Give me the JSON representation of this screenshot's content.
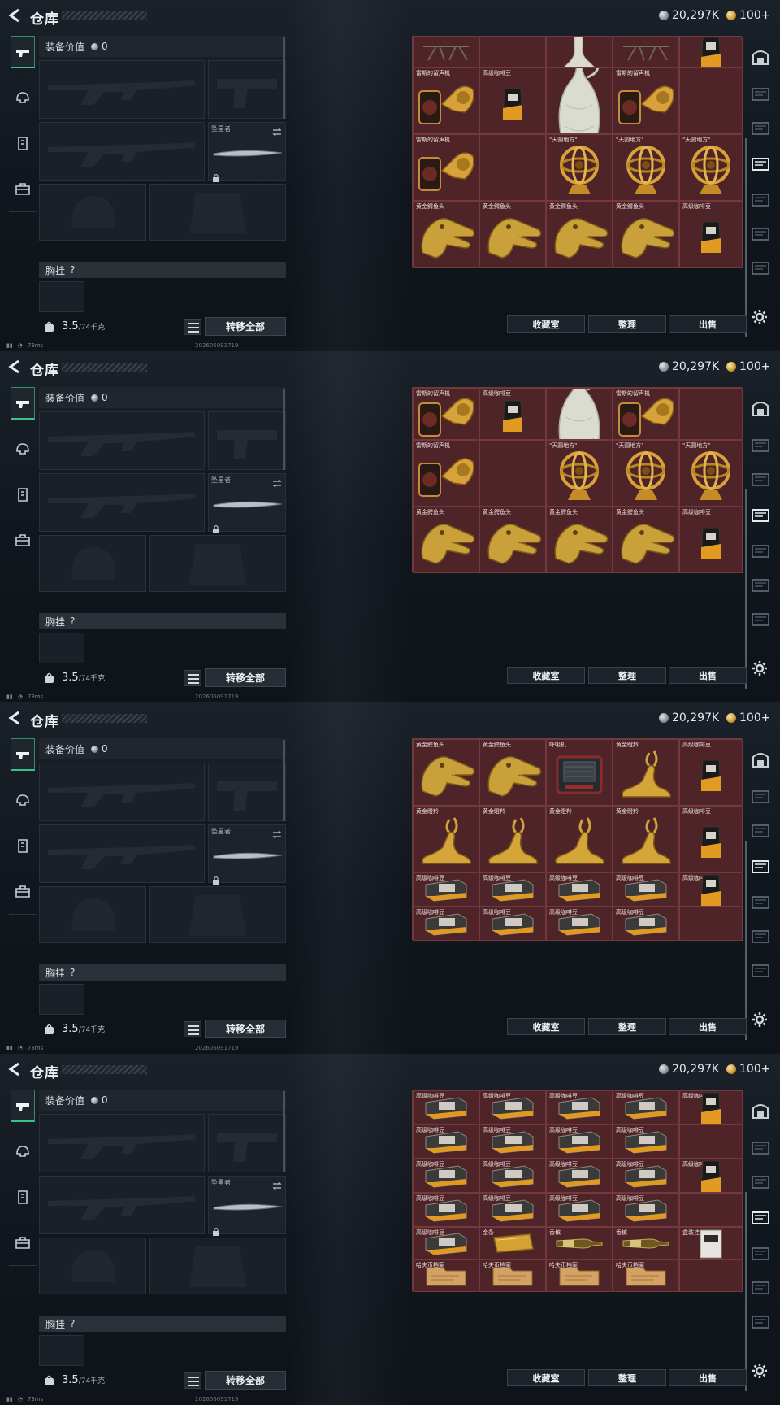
{
  "title": "仓库",
  "currency": {
    "silver": "20,297K",
    "gold": "100+"
  },
  "equip": {
    "value_label": "装备价值",
    "value": "0",
    "knife_name": "坠星者",
    "vest_label": "胸挂",
    "vest_hint": "?",
    "weight": "3.5",
    "weight_max": "/74千克",
    "transfer_label": "转移全部"
  },
  "status": {
    "ping": "73ms",
    "stamp": "202606091719"
  },
  "buttons": {
    "collection": "收藏室",
    "sort": "整理",
    "sell": "出售"
  },
  "colors": {
    "grid": "#5c2a2e",
    "active_tab": "#3cc18b"
  },
  "frames": [
    {
      "rows": [
        {
          "cells": [
            {
              "name": "",
              "icon": "tripod"
            },
            {
              "name": "",
              "icon": "none"
            },
            {
              "name": "",
              "icon": "vase-top"
            },
            {
              "name": "",
              "icon": "tripod"
            },
            {
              "name": "",
              "icon": "coffee-bag"
            }
          ]
        },
        {
          "cells": [
            {
              "name": "雷斯的留声机",
              "icon": "gramophone"
            },
            {
              "name": "高级咖啡豆",
              "icon": "coffee-bag"
            },
            {
              "name": "",
              "icon": "vase"
            },
            {
              "name": "雷斯的留声机",
              "icon": "gramophone"
            },
            {
              "name": "",
              "icon": "none"
            }
          ]
        },
        {
          "cells": [
            {
              "name": "雷斯的留声机",
              "icon": "gramophone"
            },
            {
              "name": "",
              "icon": "none"
            },
            {
              "name": "\"天圆地方\"",
              "icon": "armillary"
            },
            {
              "name": "\"天圆地方\"",
              "icon": "armillary"
            },
            {
              "name": "\"天圆地方\"",
              "icon": "armillary"
            }
          ]
        },
        {
          "cells": [
            {
              "name": "黄金鳄鱼头",
              "icon": "croc"
            },
            {
              "name": "黄金鳄鱼头",
              "icon": "croc"
            },
            {
              "name": "黄金鳄鱼头",
              "icon": "croc"
            },
            {
              "name": "黄金鳄鱼头",
              "icon": "croc"
            },
            {
              "name": "高级咖啡豆",
              "icon": "coffee-bag"
            }
          ]
        }
      ]
    },
    {
      "rows": [
        {
          "cells": [
            {
              "name": "雷斯的留声机",
              "icon": "gramophone"
            },
            {
              "name": "高级咖啡豆",
              "icon": "coffee-bag"
            },
            {
              "name": "",
              "icon": "vase"
            },
            {
              "name": "雷斯的留声机",
              "icon": "gramophone"
            },
            {
              "name": "",
              "icon": "none"
            }
          ]
        },
        {
          "cells": [
            {
              "name": "雷斯的留声机",
              "icon": "gramophone"
            },
            {
              "name": "",
              "icon": "none"
            },
            {
              "name": "\"天圆地方\"",
              "icon": "armillary"
            },
            {
              "name": "\"天圆地方\"",
              "icon": "armillary"
            },
            {
              "name": "\"天圆地方\"",
              "icon": "armillary"
            }
          ]
        },
        {
          "cells": [
            {
              "name": "黄金鳄鱼头",
              "icon": "croc"
            },
            {
              "name": "黄金鳄鱼头",
              "icon": "croc"
            },
            {
              "name": "黄金鳄鱼头",
              "icon": "croc"
            },
            {
              "name": "黄金鳄鱼头",
              "icon": "croc"
            },
            {
              "name": "高级咖啡豆",
              "icon": "coffee-bag"
            }
          ]
        }
      ]
    },
    {
      "rows": [
        {
          "cells": [
            {
              "name": "黄金鳄鱼头",
              "icon": "croc"
            },
            {
              "name": "黄金鳄鱼头",
              "icon": "croc"
            },
            {
              "name": "呼吸机",
              "icon": "ventilator"
            },
            {
              "name": "黄金瞪羚",
              "icon": "gazelle"
            },
            {
              "name": "高级咖啡豆",
              "icon": "coffee-bag"
            }
          ]
        },
        {
          "cells": [
            {
              "name": "黄金瞪羚",
              "icon": "gazelle"
            },
            {
              "name": "黄金瞪羚",
              "icon": "gazelle"
            },
            {
              "name": "黄金瞪羚",
              "icon": "gazelle"
            },
            {
              "name": "黄金瞪羚",
              "icon": "gazelle"
            },
            {
              "name": "高级咖啡豆",
              "icon": "coffee-bag"
            }
          ]
        },
        {
          "cells": [
            {
              "name": "高级咖啡豆",
              "icon": "coffee-box"
            },
            {
              "name": "高级咖啡豆",
              "icon": "coffee-box"
            },
            {
              "name": "高级咖啡豆",
              "icon": "coffee-box"
            },
            {
              "name": "高级咖啡豆",
              "icon": "coffee-box"
            },
            {
              "name": "高级咖啡豆",
              "icon": "coffee-bag"
            }
          ]
        },
        {
          "cells": [
            {
              "name": "高级咖啡豆",
              "icon": "coffee-box"
            },
            {
              "name": "高级咖啡豆",
              "icon": "coffee-box"
            },
            {
              "name": "高级咖啡豆",
              "icon": "coffee-box"
            },
            {
              "name": "高级咖啡豆",
              "icon": "coffee-box"
            },
            {
              "name": "",
              "icon": "none"
            }
          ]
        }
      ]
    },
    {
      "rows": [
        {
          "cells": [
            {
              "name": "高级咖啡豆",
              "icon": "coffee-box"
            },
            {
              "name": "高级咖啡豆",
              "icon": "coffee-box"
            },
            {
              "name": "高级咖啡豆",
              "icon": "coffee-box"
            },
            {
              "name": "高级咖啡豆",
              "icon": "coffee-box"
            },
            {
              "name": "高级咖啡豆",
              "icon": "coffee-bag"
            }
          ]
        },
        {
          "cells": [
            {
              "name": "高级咖啡豆",
              "icon": "coffee-box"
            },
            {
              "name": "高级咖啡豆",
              "icon": "coffee-box"
            },
            {
              "name": "高级咖啡豆",
              "icon": "coffee-box"
            },
            {
              "name": "高级咖啡豆",
              "icon": "coffee-box"
            },
            {
              "name": "",
              "icon": "none"
            }
          ]
        },
        {
          "cells": [
            {
              "name": "高级咖啡豆",
              "icon": "coffee-box"
            },
            {
              "name": "高级咖啡豆",
              "icon": "coffee-box"
            },
            {
              "name": "高级咖啡豆",
              "icon": "coffee-box"
            },
            {
              "name": "高级咖啡豆",
              "icon": "coffee-box"
            },
            {
              "name": "高级咖啡豆",
              "icon": "coffee-bag"
            }
          ]
        },
        {
          "cells": [
            {
              "name": "高级咖啡豆",
              "icon": "coffee-box"
            },
            {
              "name": "高级咖啡豆",
              "icon": "coffee-box"
            },
            {
              "name": "高级咖啡豆",
              "icon": "coffee-box"
            },
            {
              "name": "高级咖啡豆",
              "icon": "coffee-box"
            },
            {
              "name": "",
              "icon": "none"
            }
          ]
        },
        {
          "cells": [
            {
              "name": "高级咖啡豆",
              "icon": "coffee-box"
            },
            {
              "name": "金条",
              "icon": "gold-bar"
            },
            {
              "name": "香槟",
              "icon": "champagne"
            },
            {
              "name": "香槟",
              "icon": "champagne"
            },
            {
              "name": "盒装挂耳...",
              "icon": "drip-box"
            }
          ]
        },
        {
          "cells": [
            {
              "name": "哈夫币档案",
              "icon": "folder"
            },
            {
              "name": "哈夫币档案",
              "icon": "folder"
            },
            {
              "name": "哈夫币档案",
              "icon": "folder"
            },
            {
              "name": "哈夫币档案",
              "icon": "folder"
            },
            {
              "name": "",
              "icon": "none"
            }
          ]
        }
      ]
    }
  ]
}
